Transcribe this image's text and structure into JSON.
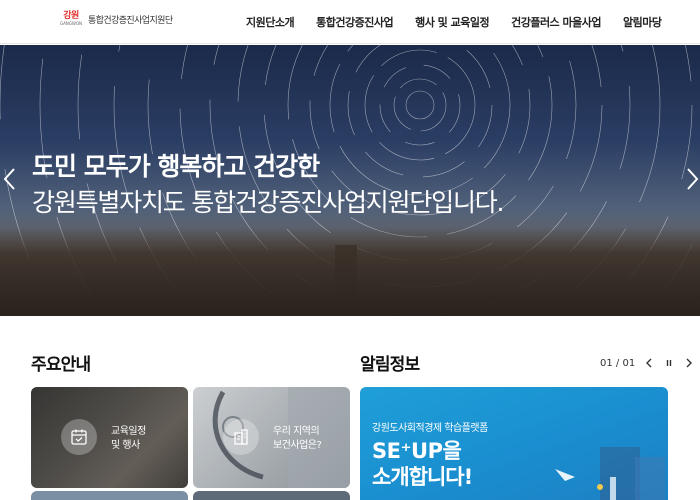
{
  "header": {
    "logo_mark": "강원",
    "logo_mark_sub": "GANGWON",
    "logo_text": "통합건강증진사업지원단",
    "nav": [
      {
        "label": "지원단소개"
      },
      {
        "label": "통합건강증진사업"
      },
      {
        "label": "행사 및 교육일정"
      },
      {
        "label": "건강플러스 마을사업"
      },
      {
        "label": "알림마당"
      }
    ]
  },
  "hero": {
    "title_line1": "도민 모두가 행복하고 건강한",
    "title_line2": "강원특별자치도 통합건강증진사업지원단입니다.",
    "prev_icon": "chevron-left-icon",
    "next_icon": "chevron-right-icon"
  },
  "main_info": {
    "title": "주요안내",
    "cards": [
      {
        "label_line1": "교육일정",
        "label_line2": "및 행사",
        "icon": "calendar-check-icon"
      },
      {
        "label_line1": "우리 지역의",
        "label_line2": "보건사업은?",
        "icon": "building-icon"
      }
    ]
  },
  "notices": {
    "title": "알림정보",
    "pager": "01 / 01",
    "promo": {
      "subtitle": "강원도사회적경제 학습플랫폼",
      "line1": "SE⁺UP을",
      "line2": "소개합니다!"
    }
  },
  "colors": {
    "accent_blue": "#1b8fd0",
    "logo_red": "#e2312d",
    "logo_blue": "#1b63b3"
  }
}
